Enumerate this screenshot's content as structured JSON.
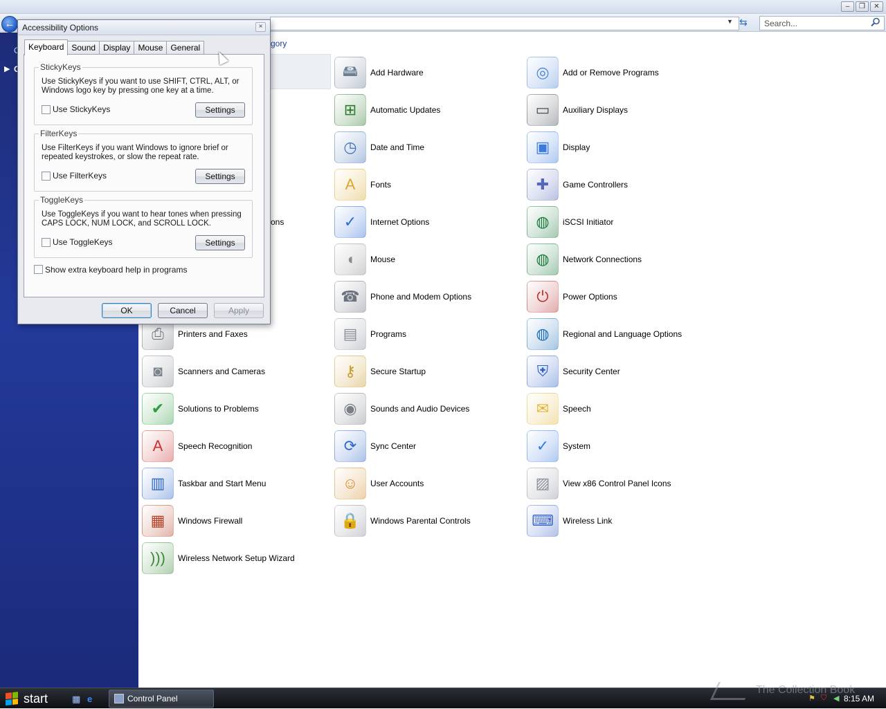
{
  "explorer": {
    "search_placeholder": "Search...",
    "breadcrumb_fragment": "gory",
    "left_pane_text_1": "C",
    "left_pane_text_2": "C",
    "partial_item_label": "ons"
  },
  "dialog": {
    "title": "Accessibility Options",
    "close_label": "×",
    "tabs": [
      "Keyboard",
      "Sound",
      "Display",
      "Mouse",
      "General"
    ],
    "active_tab": "Keyboard",
    "groups": [
      {
        "title": "StickyKeys",
        "description": "Use StickyKeys if you want to use SHIFT, CTRL, ALT, or Windows logo key by pressing one key at a time.",
        "checkbox_label": "Use StickyKeys",
        "checked": false,
        "button_label": "Settings"
      },
      {
        "title": "FilterKeys",
        "description": "Use FilterKeys if you want Windows to ignore brief or repeated keystrokes, or slow the repeat rate.",
        "checkbox_label": "Use FilterKeys",
        "checked": false,
        "button_label": "Settings"
      },
      {
        "title": "ToggleKeys",
        "description": "Use ToggleKeys if you want to hear tones when pressing CAPS LOCK, NUM LOCK, and SCROLL LOCK.",
        "checkbox_label": "Use ToggleKeys",
        "checked": false,
        "button_label": "Settings"
      }
    ],
    "extra_help_label": "Show extra keyboard help in programs",
    "extra_help_checked": false,
    "ok_label": "OK",
    "cancel_label": "Cancel",
    "apply_label": "Apply"
  },
  "control_panel_items": {
    "col2": [
      {
        "label": "Add Hardware",
        "icon": "add-hardware-icon"
      },
      {
        "label": "Automatic Updates",
        "icon": "windows-update-icon"
      },
      {
        "label": "Date and Time",
        "icon": "clock-icon"
      },
      {
        "label": "Fonts",
        "icon": "fonts-folder-icon"
      },
      {
        "label": "Internet Options",
        "icon": "internet-globe-icon"
      },
      {
        "label": "Mouse",
        "icon": "mouse-icon"
      },
      {
        "label": "Phone and Modem Options",
        "icon": "phone-modem-icon"
      },
      {
        "label": "Programs",
        "icon": "programs-icon"
      },
      {
        "label": "Secure Startup",
        "icon": "keys-icon"
      },
      {
        "label": "Sounds and Audio Devices",
        "icon": "speaker-icon"
      },
      {
        "label": "Sync Center",
        "icon": "sync-icon"
      },
      {
        "label": "User Accounts",
        "icon": "users-icon"
      },
      {
        "label": "Windows Parental Controls",
        "icon": "parental-lock-icon"
      }
    ],
    "col3": [
      {
        "label": "Add or Remove Programs",
        "icon": "add-remove-programs-icon"
      },
      {
        "label": "Auxiliary Displays",
        "icon": "auxiliary-display-icon"
      },
      {
        "label": "Display",
        "icon": "display-icon"
      },
      {
        "label": "Game Controllers",
        "icon": "gamepad-icon"
      },
      {
        "label": "iSCSI Initiator",
        "icon": "globe-network-icon"
      },
      {
        "label": "Network Connections",
        "icon": "network-globe-icon"
      },
      {
        "label": "Power Options",
        "icon": "power-plug-icon"
      },
      {
        "label": "Regional and Language Options",
        "icon": "regional-globe-icon"
      },
      {
        "label": "Security Center",
        "icon": "security-shield-icon"
      },
      {
        "label": "Speech",
        "icon": "speech-icon"
      },
      {
        "label": "System",
        "icon": "system-monitor-icon"
      },
      {
        "label": "View x86 Control Panel Icons",
        "icon": "x86-panel-icon"
      },
      {
        "label": "Wireless Link",
        "icon": "wireless-link-icon"
      }
    ],
    "col1": [
      {
        "label": "Printers and Faxes",
        "icon": "printer-icon"
      },
      {
        "label": "Scanners and Cameras",
        "icon": "scanner-camera-icon"
      },
      {
        "label": "Solutions to Problems",
        "icon": "solutions-check-icon"
      },
      {
        "label": "Speech Recognition",
        "icon": "speech-recognition-icon"
      },
      {
        "label": "Taskbar and Start Menu",
        "icon": "taskbar-icon"
      },
      {
        "label": "Windows Firewall",
        "icon": "firewall-icon"
      },
      {
        "label": "Wireless Network Setup Wizard",
        "icon": "wireless-network-icon"
      }
    ]
  },
  "taskbar": {
    "start_label": "start",
    "task_label": "Control Panel",
    "clock": "8:15 AM",
    "watermark": "The Collection Book"
  },
  "colors": {
    "left_pane": "#233a9a",
    "taskbar": "#1a1d23",
    "link": "#1c3f9a"
  }
}
